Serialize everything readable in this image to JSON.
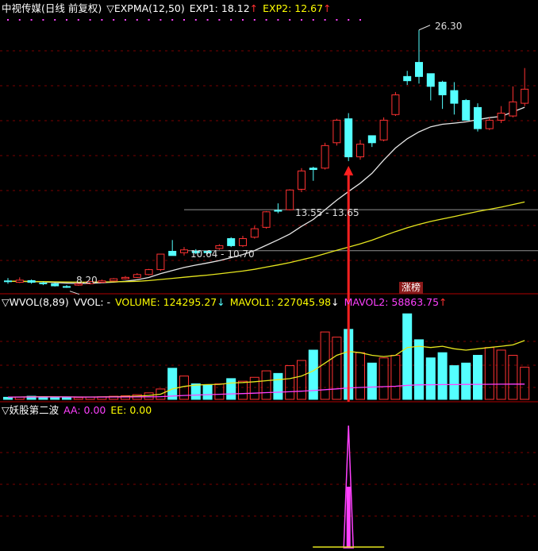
{
  "colors": {
    "up": "#ff3232",
    "down": "#54ffff",
    "exp1": "#e6e6e6",
    "exp2": "#e6e61e",
    "mavol1": "#e6e61e",
    "mavol2": "#ff40ff",
    "grid": "#7a0000",
    "arrow": "#ff2020",
    "signal": "#ff40ff",
    "baseline": "#e6e61e"
  },
  "main_header": {
    "stock": "中视传媒(日线 前复权)",
    "indicator": "▽EXPMA(12,50)",
    "exp1": "EXP1: 18.12",
    "exp1_arrow": "↑",
    "exp2": "EXP2: 12.67",
    "exp2_arrow": "↑"
  },
  "volume_header": {
    "title": "▽WVOL(8,89)",
    "vvol": "VVOL: -",
    "volume": "VOLUME: 124295.27",
    "volume_arrow": "↓",
    "mavol1": "MAVOL1: 227045.98",
    "mavol1_arrow": "↓",
    "mavol2": "MAVOL2: 58863.75",
    "mavol2_arrow": "↑"
  },
  "signal_header": {
    "title": "▽妖股第二波",
    "aa": "AA: 0.00",
    "ee": "EE: 0.00"
  },
  "annotations": {
    "high": "26.30",
    "low": "8.20",
    "zone1": "13.55 - 13.65",
    "zone2": "10.64 - 10.70",
    "tag": "涨榜"
  },
  "chart_data": [
    {
      "type": "candlestick",
      "title": "中视传媒(日线 前复权)",
      "series": [
        {
          "name": "EXP1",
          "values": [
            8.48,
            8.47,
            8.45,
            8.43,
            8.38,
            8.34,
            8.32,
            8.33,
            8.37,
            8.41,
            8.48,
            8.58,
            8.74,
            9.02,
            9.24,
            9.45,
            9.62,
            9.77,
            9.94,
            10.15,
            10.37,
            10.65,
            11.03,
            11.41,
            11.82,
            12.37,
            12.86,
            13.54,
            14.23,
            14.84,
            15.43,
            16.13,
            17.07,
            17.93,
            18.58,
            19.07,
            19.43,
            19.61,
            19.69,
            19.78,
            19.94,
            20.08,
            20.17,
            20.49,
            20.82
          ]
        },
        {
          "name": "EXP2",
          "values": [
            8.48,
            8.47,
            8.46,
            8.45,
            8.43,
            8.42,
            8.41,
            8.41,
            8.42,
            8.43,
            8.45,
            8.47,
            8.52,
            8.6,
            8.68,
            8.76,
            8.84,
            8.91,
            9.0,
            9.1,
            9.2,
            9.32,
            9.48,
            9.63,
            9.8,
            10.0,
            10.19,
            10.43,
            10.67,
            10.9,
            11.13,
            11.39,
            11.7,
            12.0,
            12.27,
            12.51,
            12.72,
            12.9,
            13.07,
            13.25,
            13.42,
            13.58,
            13.73,
            13.92,
            14.1
          ]
        }
      ],
      "candles": [
        [
          8.5,
          8.45,
          8.7,
          8.3
        ],
        [
          8.4,
          8.55,
          8.75,
          8.35
        ],
        [
          8.52,
          8.4,
          8.6,
          8.3
        ],
        [
          8.35,
          8.3,
          8.45,
          8.2
        ],
        [
          8.3,
          8.15,
          8.35,
          8.1
        ],
        [
          8.1,
          8.05,
          8.2,
          8.0
        ],
        [
          8.2,
          8.3,
          8.35,
          8.15
        ],
        [
          8.3,
          8.45,
          8.5,
          8.25
        ],
        [
          8.4,
          8.5,
          8.6,
          8.35
        ],
        [
          8.5,
          8.65,
          8.7,
          8.45
        ],
        [
          8.65,
          8.75,
          8.85,
          8.6
        ],
        [
          8.75,
          8.95,
          9.05,
          8.7
        ],
        [
          8.95,
          9.3,
          9.35,
          8.9
        ],
        [
          9.3,
          10.4,
          10.4,
          9.2
        ],
        [
          10.6,
          10.3,
          11.4,
          10.3
        ],
        [
          10.5,
          10.7,
          10.9,
          10.3
        ],
        [
          10.6,
          10.5,
          10.75,
          10.4
        ],
        [
          10.6,
          10.5,
          10.6,
          10.4
        ],
        [
          10.8,
          11.0,
          11.1,
          10.7
        ],
        [
          11.5,
          11.0,
          11.6,
          10.9
        ],
        [
          11.0,
          11.5,
          11.7,
          10.9
        ],
        [
          11.6,
          12.2,
          12.4,
          11.5
        ],
        [
          12.3,
          13.4,
          13.45,
          12.2
        ],
        [
          13.5,
          13.45,
          14.0,
          13.3
        ],
        [
          13.55,
          14.95,
          15.0,
          13.5
        ],
        [
          15.0,
          16.3,
          16.5,
          14.8
        ],
        [
          16.5,
          16.4,
          16.6,
          15.6
        ],
        [
          16.5,
          18.1,
          18.3,
          16.4
        ],
        [
          18.3,
          19.9,
          20.0,
          18.1
        ],
        [
          20.0,
          17.3,
          20.4,
          17.0
        ],
        [
          17.3,
          18.2,
          18.5,
          17.1
        ],
        [
          18.8,
          18.3,
          18.7,
          18.0
        ],
        [
          18.5,
          19.9,
          20.1,
          18.4
        ],
        [
          20.3,
          21.7,
          21.9,
          20.2
        ],
        [
          23.0,
          22.7,
          23.4,
          22.4
        ],
        [
          24.0,
          23.0,
          26.3,
          22.5
        ],
        [
          23.2,
          22.3,
          23.2,
          21.3
        ],
        [
          22.6,
          21.7,
          22.7,
          20.7
        ],
        [
          22.0,
          21.1,
          22.6,
          20.3
        ],
        [
          21.3,
          19.9,
          21.4,
          19.9
        ],
        [
          20.8,
          19.3,
          21.1,
          19.1
        ],
        [
          19.3,
          19.9,
          20.1,
          19.2
        ],
        [
          19.9,
          20.4,
          20.9,
          19.7
        ],
        [
          20.2,
          21.2,
          22.3,
          20.1
        ],
        [
          21.1,
          22.1,
          23.6,
          20.9
        ]
      ],
      "signal_index": 29,
      "ylim": [
        7.7,
        27.3
      ],
      "levels": [
        13.55,
        13.65,
        10.64,
        10.7
      ]
    },
    {
      "type": "bar",
      "title": "WVOL(8,89)",
      "series": [
        {
          "name": "VOLUME",
          "values": [
            8000,
            9000,
            12000,
            10000,
            9000,
            8000,
            7000,
            9000,
            10000,
            12000,
            14000,
            18000,
            25000,
            40000,
            120000,
            90000,
            60000,
            55000,
            60000,
            80000,
            70000,
            85000,
            110000,
            100000,
            130000,
            150000,
            190000,
            260000,
            240000,
            270000,
            180000,
            140000,
            160000,
            170000,
            330000,
            230000,
            160000,
            180000,
            130000,
            140000,
            170000,
            200000,
            190000,
            170000,
            124295.27
          ]
        },
        {
          "name": "MAVOL1",
          "values": [
            9000,
            9200,
            9800,
            10000,
            9800,
            9500,
            9200,
            9300,
            9500,
            10200,
            11000,
            12500,
            15000,
            20000,
            40000,
            50000,
            55000,
            57000,
            58000,
            63000,
            65000,
            68000,
            72000,
            76000,
            80000,
            90000,
            110000,
            140000,
            170000,
            185000,
            180000,
            170000,
            165000,
            170000,
            200000,
            205000,
            200000,
            205000,
            195000,
            190000,
            195000,
            200000,
            205000,
            210000,
            227045.98
          ]
        },
        {
          "name": "MAVOL2",
          "values": [
            9000,
            9000,
            9100,
            9100,
            9100,
            9100,
            9000,
            9000,
            9000,
            9100,
            9200,
            9400,
            9800,
            10400,
            13000,
            15000,
            16500,
            18000,
            19500,
            21000,
            22500,
            24000,
            26000,
            27500,
            29500,
            31500,
            34000,
            37500,
            40500,
            44000,
            46000,
            47500,
            49000,
            50500,
            54000,
            56000,
            56500,
            57000,
            57000,
            57500,
            58000,
            58300,
            58500,
            58700,
            58863.75
          ]
        }
      ],
      "up_flags": [
        0,
        1,
        0,
        0,
        0,
        0,
        1,
        1,
        1,
        1,
        1,
        1,
        1,
        1,
        0,
        1,
        0,
        0,
        1,
        0,
        1,
        1,
        1,
        0,
        1,
        1,
        0,
        1,
        1,
        0,
        1,
        0,
        1,
        1,
        0,
        0,
        0,
        0,
        0,
        0,
        0,
        1,
        1,
        1,
        1
      ],
      "ylim": [
        0,
        340000
      ]
    },
    {
      "type": "line",
      "title": "妖股第二波",
      "series": [
        {
          "name": "AA",
          "values": [
            0,
            0,
            0,
            0,
            0,
            0,
            0,
            0,
            0,
            0,
            0,
            0,
            0,
            0,
            0,
            0,
            0,
            0,
            0,
            0,
            0,
            0,
            0,
            0,
            0,
            0,
            0,
            0,
            0,
            1,
            0,
            0,
            0,
            0,
            0,
            0,
            0,
            0,
            0,
            0,
            0,
            0,
            0,
            0,
            0
          ]
        },
        {
          "name": "EE",
          "values": [
            0,
            0,
            0,
            0,
            0,
            0,
            0,
            0,
            0,
            0,
            0,
            0,
            0,
            0,
            0,
            0,
            0,
            0,
            0,
            0,
            0,
            0,
            0,
            0,
            0,
            0,
            0,
            0,
            0,
            0,
            0,
            0,
            0,
            0,
            0,
            0,
            0,
            0,
            0,
            0,
            0,
            0,
            0,
            0,
            0
          ]
        }
      ],
      "ylim": [
        0,
        1
      ]
    }
  ]
}
